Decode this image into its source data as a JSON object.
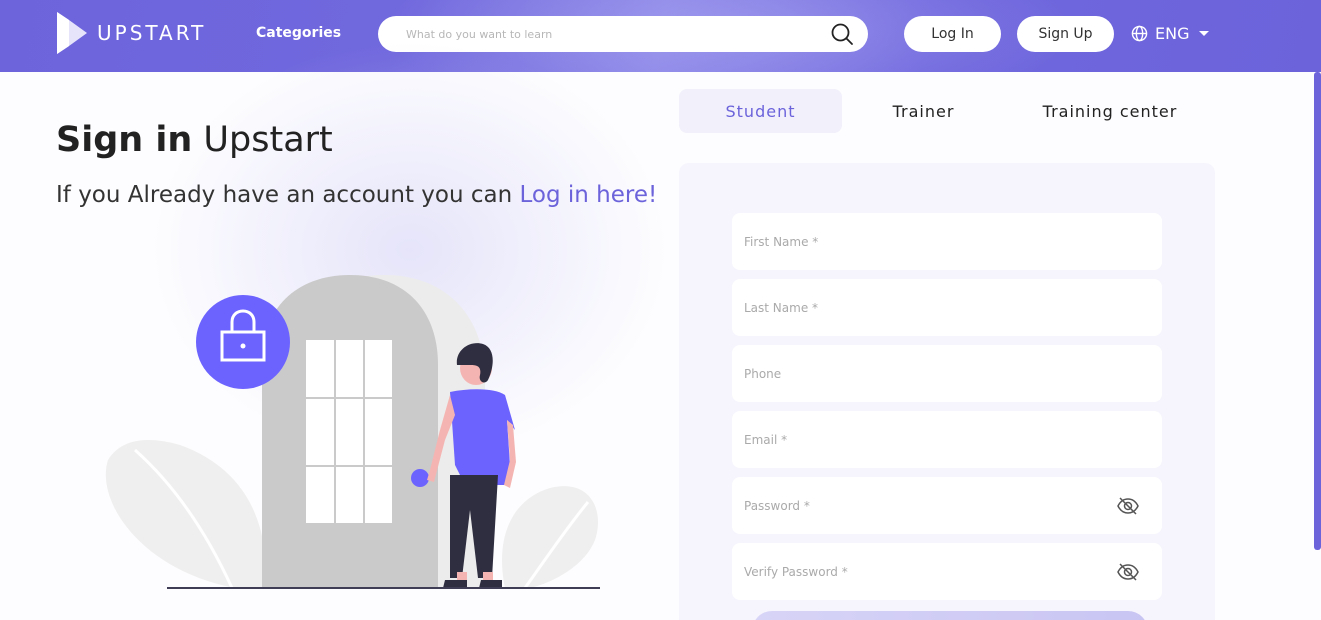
{
  "header": {
    "logo_text": "UPSTART",
    "categories_label": "Categories",
    "search_placeholder": "What do you want to learn",
    "login_label": "Log In",
    "signup_label": "Sign Up",
    "language_label": "ENG",
    "search_icon": "search-icon",
    "globe_icon": "globe-icon"
  },
  "hero": {
    "title_bold": "Sign in",
    "title_rest": "Upstart",
    "subtitle_prefix": "If you Already have an account you can",
    "subtitle_link": "Log in here!"
  },
  "tabs": [
    {
      "label": "Student",
      "active": true
    },
    {
      "label": "Trainer",
      "active": false
    },
    {
      "label": "Training center",
      "active": false
    }
  ],
  "form": {
    "fields": [
      {
        "placeholder": "First Name *",
        "type": "text"
      },
      {
        "placeholder": "Last Name *",
        "type": "text"
      },
      {
        "placeholder": "Phone",
        "type": "text"
      },
      {
        "placeholder": "Email *",
        "type": "text"
      },
      {
        "placeholder": "Password *",
        "type": "password"
      },
      {
        "placeholder": "Verify Password *",
        "type": "password"
      }
    ]
  },
  "colors": {
    "brand": "#6c63db",
    "card_bg": "#f6f5fd",
    "lock_circle": "#6c63ff"
  }
}
